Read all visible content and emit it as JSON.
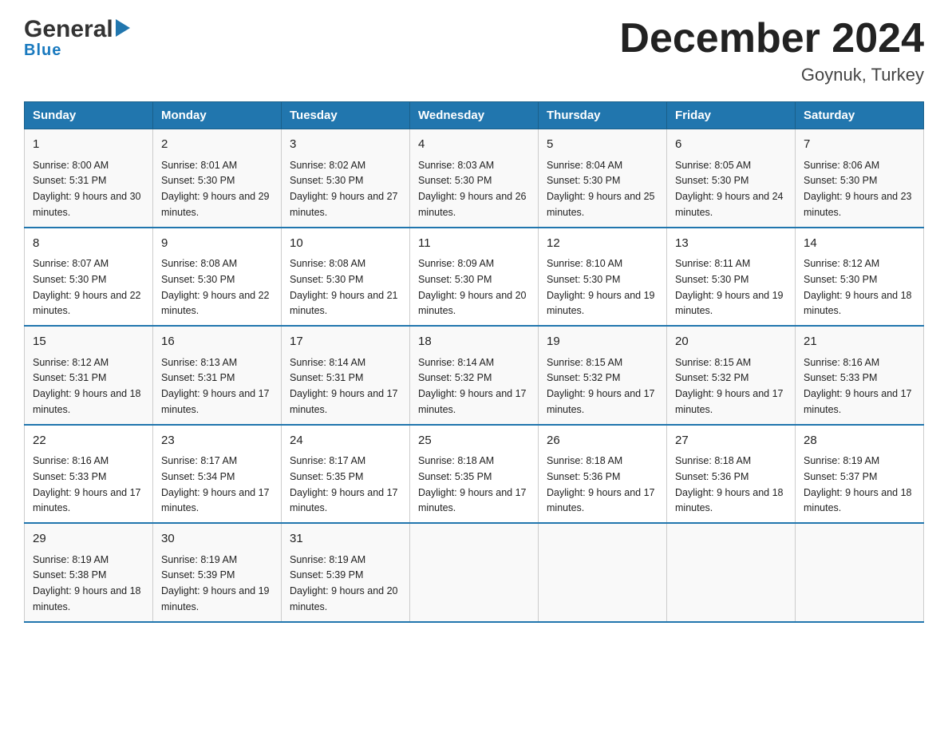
{
  "header": {
    "logo_general": "General",
    "logo_blue": "Blue",
    "title": "December 2024",
    "subtitle": "Goynuk, Turkey"
  },
  "days_of_week": [
    "Sunday",
    "Monday",
    "Tuesday",
    "Wednesday",
    "Thursday",
    "Friday",
    "Saturday"
  ],
  "weeks": [
    [
      {
        "day": "1",
        "sunrise": "Sunrise: 8:00 AM",
        "sunset": "Sunset: 5:31 PM",
        "daylight": "Daylight: 9 hours and 30 minutes."
      },
      {
        "day": "2",
        "sunrise": "Sunrise: 8:01 AM",
        "sunset": "Sunset: 5:30 PM",
        "daylight": "Daylight: 9 hours and 29 minutes."
      },
      {
        "day": "3",
        "sunrise": "Sunrise: 8:02 AM",
        "sunset": "Sunset: 5:30 PM",
        "daylight": "Daylight: 9 hours and 27 minutes."
      },
      {
        "day": "4",
        "sunrise": "Sunrise: 8:03 AM",
        "sunset": "Sunset: 5:30 PM",
        "daylight": "Daylight: 9 hours and 26 minutes."
      },
      {
        "day": "5",
        "sunrise": "Sunrise: 8:04 AM",
        "sunset": "Sunset: 5:30 PM",
        "daylight": "Daylight: 9 hours and 25 minutes."
      },
      {
        "day": "6",
        "sunrise": "Sunrise: 8:05 AM",
        "sunset": "Sunset: 5:30 PM",
        "daylight": "Daylight: 9 hours and 24 minutes."
      },
      {
        "day": "7",
        "sunrise": "Sunrise: 8:06 AM",
        "sunset": "Sunset: 5:30 PM",
        "daylight": "Daylight: 9 hours and 23 minutes."
      }
    ],
    [
      {
        "day": "8",
        "sunrise": "Sunrise: 8:07 AM",
        "sunset": "Sunset: 5:30 PM",
        "daylight": "Daylight: 9 hours and 22 minutes."
      },
      {
        "day": "9",
        "sunrise": "Sunrise: 8:08 AM",
        "sunset": "Sunset: 5:30 PM",
        "daylight": "Daylight: 9 hours and 22 minutes."
      },
      {
        "day": "10",
        "sunrise": "Sunrise: 8:08 AM",
        "sunset": "Sunset: 5:30 PM",
        "daylight": "Daylight: 9 hours and 21 minutes."
      },
      {
        "day": "11",
        "sunrise": "Sunrise: 8:09 AM",
        "sunset": "Sunset: 5:30 PM",
        "daylight": "Daylight: 9 hours and 20 minutes."
      },
      {
        "day": "12",
        "sunrise": "Sunrise: 8:10 AM",
        "sunset": "Sunset: 5:30 PM",
        "daylight": "Daylight: 9 hours and 19 minutes."
      },
      {
        "day": "13",
        "sunrise": "Sunrise: 8:11 AM",
        "sunset": "Sunset: 5:30 PM",
        "daylight": "Daylight: 9 hours and 19 minutes."
      },
      {
        "day": "14",
        "sunrise": "Sunrise: 8:12 AM",
        "sunset": "Sunset: 5:30 PM",
        "daylight": "Daylight: 9 hours and 18 minutes."
      }
    ],
    [
      {
        "day": "15",
        "sunrise": "Sunrise: 8:12 AM",
        "sunset": "Sunset: 5:31 PM",
        "daylight": "Daylight: 9 hours and 18 minutes."
      },
      {
        "day": "16",
        "sunrise": "Sunrise: 8:13 AM",
        "sunset": "Sunset: 5:31 PM",
        "daylight": "Daylight: 9 hours and 17 minutes."
      },
      {
        "day": "17",
        "sunrise": "Sunrise: 8:14 AM",
        "sunset": "Sunset: 5:31 PM",
        "daylight": "Daylight: 9 hours and 17 minutes."
      },
      {
        "day": "18",
        "sunrise": "Sunrise: 8:14 AM",
        "sunset": "Sunset: 5:32 PM",
        "daylight": "Daylight: 9 hours and 17 minutes."
      },
      {
        "day": "19",
        "sunrise": "Sunrise: 8:15 AM",
        "sunset": "Sunset: 5:32 PM",
        "daylight": "Daylight: 9 hours and 17 minutes."
      },
      {
        "day": "20",
        "sunrise": "Sunrise: 8:15 AM",
        "sunset": "Sunset: 5:32 PM",
        "daylight": "Daylight: 9 hours and 17 minutes."
      },
      {
        "day": "21",
        "sunrise": "Sunrise: 8:16 AM",
        "sunset": "Sunset: 5:33 PM",
        "daylight": "Daylight: 9 hours and 17 minutes."
      }
    ],
    [
      {
        "day": "22",
        "sunrise": "Sunrise: 8:16 AM",
        "sunset": "Sunset: 5:33 PM",
        "daylight": "Daylight: 9 hours and 17 minutes."
      },
      {
        "day": "23",
        "sunrise": "Sunrise: 8:17 AM",
        "sunset": "Sunset: 5:34 PM",
        "daylight": "Daylight: 9 hours and 17 minutes."
      },
      {
        "day": "24",
        "sunrise": "Sunrise: 8:17 AM",
        "sunset": "Sunset: 5:35 PM",
        "daylight": "Daylight: 9 hours and 17 minutes."
      },
      {
        "day": "25",
        "sunrise": "Sunrise: 8:18 AM",
        "sunset": "Sunset: 5:35 PM",
        "daylight": "Daylight: 9 hours and 17 minutes."
      },
      {
        "day": "26",
        "sunrise": "Sunrise: 8:18 AM",
        "sunset": "Sunset: 5:36 PM",
        "daylight": "Daylight: 9 hours and 17 minutes."
      },
      {
        "day": "27",
        "sunrise": "Sunrise: 8:18 AM",
        "sunset": "Sunset: 5:36 PM",
        "daylight": "Daylight: 9 hours and 18 minutes."
      },
      {
        "day": "28",
        "sunrise": "Sunrise: 8:19 AM",
        "sunset": "Sunset: 5:37 PM",
        "daylight": "Daylight: 9 hours and 18 minutes."
      }
    ],
    [
      {
        "day": "29",
        "sunrise": "Sunrise: 8:19 AM",
        "sunset": "Sunset: 5:38 PM",
        "daylight": "Daylight: 9 hours and 18 minutes."
      },
      {
        "day": "30",
        "sunrise": "Sunrise: 8:19 AM",
        "sunset": "Sunset: 5:39 PM",
        "daylight": "Daylight: 9 hours and 19 minutes."
      },
      {
        "day": "31",
        "sunrise": "Sunrise: 8:19 AM",
        "sunset": "Sunset: 5:39 PM",
        "daylight": "Daylight: 9 hours and 20 minutes."
      },
      {
        "day": "",
        "sunrise": "",
        "sunset": "",
        "daylight": ""
      },
      {
        "day": "",
        "sunrise": "",
        "sunset": "",
        "daylight": ""
      },
      {
        "day": "",
        "sunrise": "",
        "sunset": "",
        "daylight": ""
      },
      {
        "day": "",
        "sunrise": "",
        "sunset": "",
        "daylight": ""
      }
    ]
  ]
}
